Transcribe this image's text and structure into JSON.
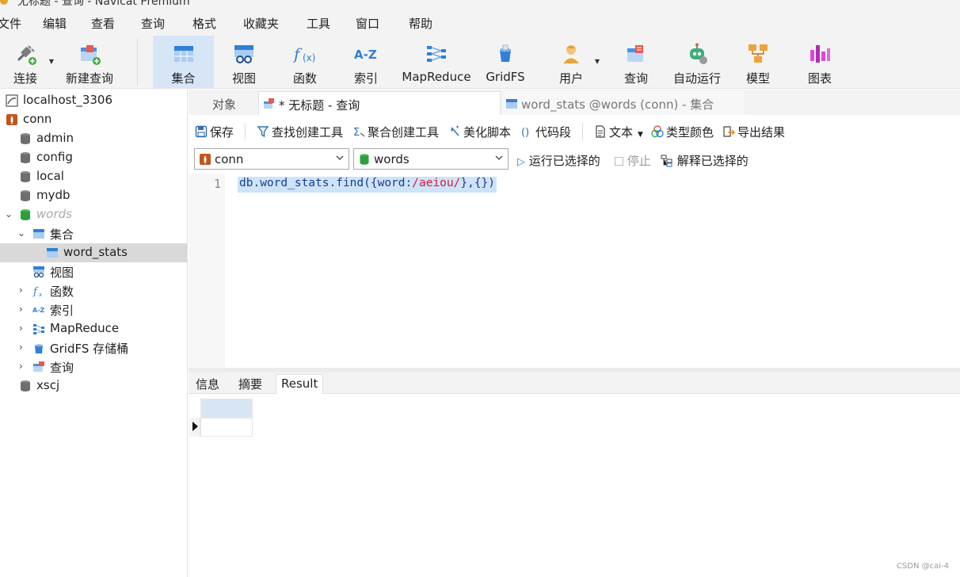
{
  "window": {
    "title": "无标题 - 查询 - Navicat Premium"
  },
  "menu": [
    "文件",
    "编辑",
    "查看",
    "查询",
    "格式",
    "收藏夹",
    "工具",
    "窗口",
    "帮助"
  ],
  "toolbar": {
    "connect": "连接",
    "new_query": "新建查询",
    "collection": "集合",
    "view": "视图",
    "function": "函数",
    "index": "索引",
    "mapreduce": "MapReduce",
    "gridfs": "GridFS",
    "user": "用户",
    "query": "查询",
    "auto_run": "自动运行",
    "model": "模型",
    "chart": "图表"
  },
  "tree": {
    "localhost": "localhost_3306",
    "conn": "conn",
    "admin": "admin",
    "config": "config",
    "local": "local",
    "mydb": "mydb",
    "words": "words",
    "collections": "集合",
    "word_stats": "word_stats",
    "views": "视图",
    "functions": "函数",
    "indexes": "索引",
    "mapreduce": "MapReduce",
    "gridfs": "GridFS 存储桶",
    "queries": "查询",
    "xscj": "xscj"
  },
  "tabs": {
    "objects": "对象",
    "query_tab": "* 无标题 - 查询",
    "collection_tab": "word_stats @words (conn) - 集合"
  },
  "query_toolbar": {
    "save": "保存",
    "find_builder": "查找创建工具",
    "aggregate_builder": "聚合创建工具",
    "beautify": "美化脚本",
    "snippet": "代码段",
    "text": "文本",
    "type_color": "类型颜色",
    "export": "导出结果"
  },
  "selectors": {
    "connection": "conn",
    "database": "words",
    "run_selected": "运行已选择的",
    "stop": "停止",
    "explain_selected": "解释已选择的"
  },
  "editor": {
    "line_number": "1",
    "code_a": "db.word_stats.find({word:",
    "code_regex": "/aeiou/",
    "code_b": "},{})"
  },
  "result_tabs": {
    "info": "信息",
    "summary": "摘要",
    "result": "Result"
  },
  "watermark": "CSDN @cai-4"
}
